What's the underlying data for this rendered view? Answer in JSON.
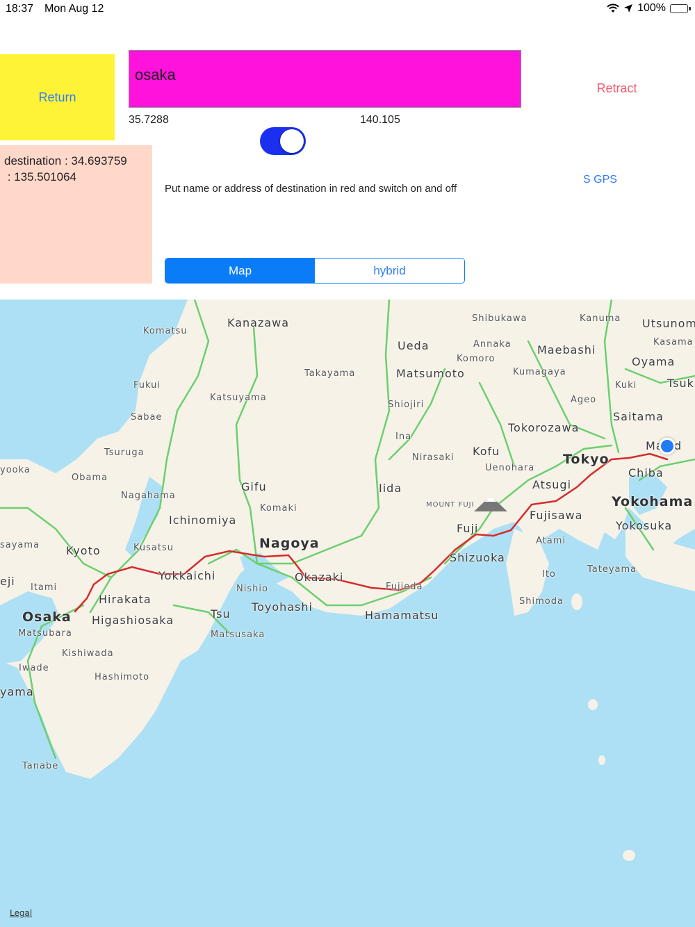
{
  "status_bar": {
    "time": "18:37",
    "date": "Mon Aug 12",
    "battery": "100%",
    "icons": [
      "wifi-icon",
      "location-arrow-icon",
      "battery-charging-icon"
    ]
  },
  "controls": {
    "return_label": "Return",
    "search_value": "osaka",
    "latitude": "35.7288",
    "longitude": "140.105",
    "retract_label": "Retract",
    "toggle_on": true,
    "destination_text": "destination : 34.693759\n : 135.501064",
    "instruction": "Put name or address of destination in red  and switch on and off",
    "sgps_label": "S GPS"
  },
  "segmented": {
    "options": [
      "Map",
      "hybrid"
    ],
    "selected": "Map"
  },
  "map": {
    "legal": "Legal",
    "places": {
      "kanazawa": "Kanazawa",
      "komatsu": "Komatsu",
      "fukui": "Fukui",
      "sabae": "Sabae",
      "tsuruga": "Tsuruga",
      "obama": "Obama",
      "nagahama": "Nagahama",
      "yooka": "yooka",
      "kyoto": "Kyoto",
      "kusatsu": "Kusatsu",
      "sayama": "sayama",
      "eji": "eji",
      "itami": "Itami",
      "osaka": "Osaka",
      "hirakata": "Hirakata",
      "higashiosaka": "Higashiosaka",
      "matsubara": "Matsubara",
      "kishiwada": "Kishiwada",
      "iwade": "Iwade",
      "hashimoto": "Hashimoto",
      "yama": "yama",
      "tanabe": "Tanabe",
      "yokkaichi": "Yokkaichi",
      "tsu": "Tsu",
      "matsusaka": "Matsusaka",
      "nishio": "Nishio",
      "toyohashi": "Toyohashi",
      "hamamatsu": "Hamamatsu",
      "okazaki": "Okazaki",
      "nagoya": "Nagoya",
      "ichinomiya": "Ichinomiya",
      "komaki": "Komaki",
      "gifu": "Gifu",
      "katsuyama": "Katsuyama",
      "takayama": "Takayama",
      "matsumoto": "Matsumoto",
      "ueda": "Ueda",
      "shiojiri": "Shiojiri",
      "ina": "Ina",
      "iida": "Iida",
      "nirasaki": "Nirasaki",
      "kofu": "Kofu",
      "uenohara": "Uenohara",
      "mount_fuji": "MOUNT FUJI",
      "fuji": "Fuji",
      "shizuoka": "Shizuoka",
      "fujieda": "Fujieda",
      "ito": "Ito",
      "shimoda": "Shimoda",
      "atami": "Atami",
      "fujisawa": "Fujisawa",
      "atsugi": "Atsugi",
      "tokorozawa": "Tokorozawa",
      "tokyo": "Tokyo",
      "yokohama": "Yokohama",
      "yokosuka": "Yokosuka",
      "tateyama": "Tateyama",
      "chiba": "Chiba",
      "matsudo": "Ma ud",
      "saitama": "Saitama",
      "ageo": "Ageo",
      "kuki": "Kuki",
      "kumagaya": "Kumagaya",
      "maebashi": "Maebashi",
      "annaka": "Annaka",
      "komoro": "Komoro",
      "shibukawa": "Shibukawa",
      "kanuma": "Kanuma",
      "utsunomiya": "Utsunom",
      "kasama": "Kasama",
      "oyama": "Oyama",
      "tsukuba": "Tsuk"
    }
  }
}
